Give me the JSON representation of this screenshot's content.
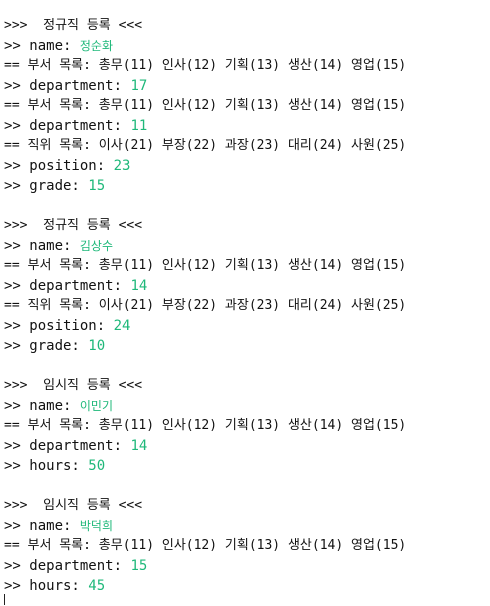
{
  "colors": {
    "text": "#111111",
    "input_value": "#1fb87a",
    "background": "#ffffff"
  },
  "blocks": [
    {
      "lines": [
        {
          "kind": "header",
          "text": ">>>  정규직 등록 <<<"
        },
        {
          "kind": "input",
          "prompt": ">> name: ",
          "value": "정순화",
          "korean": true
        },
        {
          "kind": "info",
          "text": "== 부서 목록: 총무(11) 인사(12) 기획(13) 생산(14) 영업(15)"
        },
        {
          "kind": "input",
          "prompt": ">> department: ",
          "value": "17"
        },
        {
          "kind": "info",
          "text": "== 부서 목록: 총무(11) 인사(12) 기획(13) 생산(14) 영업(15)"
        },
        {
          "kind": "input",
          "prompt": ">> department: ",
          "value": "11"
        },
        {
          "kind": "info",
          "text": "== 직위 목록: 이사(21) 부장(22) 과장(23) 대리(24) 사원(25)"
        },
        {
          "kind": "input",
          "prompt": ">> position: ",
          "value": "23"
        },
        {
          "kind": "input",
          "prompt": ">> grade: ",
          "value": "15"
        }
      ]
    },
    {
      "lines": [
        {
          "kind": "header",
          "text": ">>>  정규직 등록 <<<"
        },
        {
          "kind": "input",
          "prompt": ">> name: ",
          "value": "김상수",
          "korean": true
        },
        {
          "kind": "info",
          "text": "== 부서 목록: 총무(11) 인사(12) 기획(13) 생산(14) 영업(15)"
        },
        {
          "kind": "input",
          "prompt": ">> department: ",
          "value": "14"
        },
        {
          "kind": "info",
          "text": "== 직위 목록: 이사(21) 부장(22) 과장(23) 대리(24) 사원(25)"
        },
        {
          "kind": "input",
          "prompt": ">> position: ",
          "value": "24"
        },
        {
          "kind": "input",
          "prompt": ">> grade: ",
          "value": "10"
        }
      ]
    },
    {
      "lines": [
        {
          "kind": "header",
          "text": ">>>  임시직 등록 <<<"
        },
        {
          "kind": "input",
          "prompt": ">> name: ",
          "value": "이민기",
          "korean": true
        },
        {
          "kind": "info",
          "text": "== 부서 목록: 총무(11) 인사(12) 기획(13) 생산(14) 영업(15)"
        },
        {
          "kind": "input",
          "prompt": ">> department: ",
          "value": "14"
        },
        {
          "kind": "input",
          "prompt": ">> hours: ",
          "value": "50"
        }
      ]
    },
    {
      "lines": [
        {
          "kind": "header",
          "text": ">>>  임시직 등록 <<<"
        },
        {
          "kind": "input",
          "prompt": ">> name: ",
          "value": "박덕희",
          "korean": true
        },
        {
          "kind": "info",
          "text": "== 부서 목록: 총무(11) 인사(12) 기획(13) 생산(14) 영업(15)"
        },
        {
          "kind": "input",
          "prompt": ">> department: ",
          "value": "15"
        },
        {
          "kind": "input",
          "prompt": ">> hours: ",
          "value": "45"
        }
      ]
    }
  ]
}
